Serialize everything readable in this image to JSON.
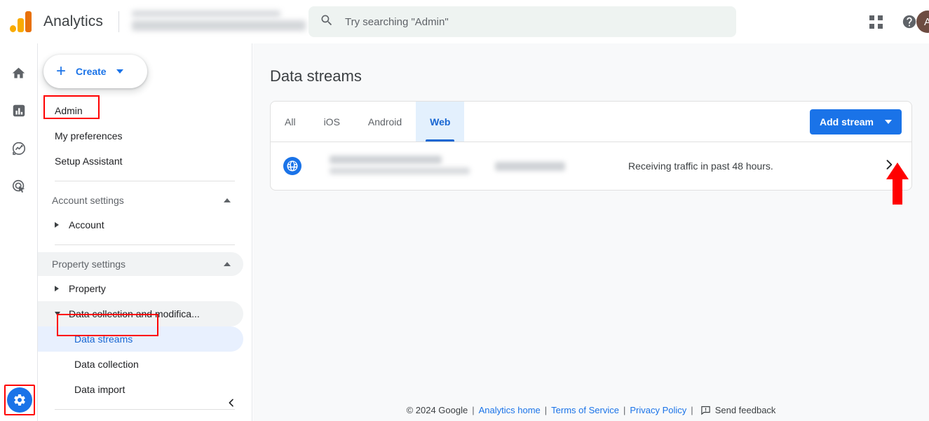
{
  "header": {
    "app_title": "Analytics",
    "account_blurred": true,
    "search_placeholder": "Try searching \"Admin\"",
    "search_icon": "search-icon",
    "apps_icon": "apps-grid-icon",
    "help_icon": "help-icon",
    "avatar_initial": "A"
  },
  "rail": {
    "items": [
      {
        "icon": "home-icon",
        "name": "home"
      },
      {
        "icon": "reports-bar-chart-icon",
        "name": "reports"
      },
      {
        "icon": "explore-icon",
        "name": "explore"
      },
      {
        "icon": "advertising-target-icon",
        "name": "advertising"
      }
    ],
    "admin_gear_icon": "gear-icon"
  },
  "sidebar": {
    "create_label": "Create",
    "create_icon": "plus-icon",
    "top_items": [
      {
        "label": "Admin",
        "selected": false,
        "annotated": true
      },
      {
        "label": "My preferences",
        "selected": false,
        "annotated": false
      },
      {
        "label": "Setup Assistant",
        "selected": false,
        "annotated": false
      }
    ],
    "sections": [
      {
        "title": "Account settings",
        "expanded": true,
        "items": [
          {
            "label": "Account",
            "expandable": true,
            "expanded": false,
            "selected": false
          }
        ]
      },
      {
        "title": "Property settings",
        "expanded": true,
        "items": [
          {
            "label": "Property",
            "expandable": true,
            "expanded": false,
            "selected": false
          },
          {
            "label": "Data collection and modifica...",
            "expandable": true,
            "expanded": true,
            "selected": false
          },
          {
            "label": "Data streams",
            "expandable": false,
            "selected": true,
            "annotated": true
          },
          {
            "label": "Data collection",
            "expandable": false,
            "selected": false
          },
          {
            "label": "Data import",
            "expandable": false,
            "selected": false
          }
        ]
      }
    ],
    "collapse_icon": "chevron-left-icon"
  },
  "main": {
    "page_title": "Data streams",
    "tabs": [
      {
        "label": "All",
        "active": false
      },
      {
        "label": "iOS",
        "active": false
      },
      {
        "label": "Android",
        "active": false
      },
      {
        "label": "Web",
        "active": true
      }
    ],
    "add_stream_label": "Add stream",
    "streams": [
      {
        "icon": "globe-icon",
        "name_blurred": true,
        "url_blurred": true,
        "measurement_id_blurred": true,
        "status": "Receiving traffic in past 48 hours.",
        "chevron": "chevron-right-icon"
      }
    ]
  },
  "footer": {
    "copyright": "© 2024 Google",
    "links": [
      {
        "label": "Analytics home"
      },
      {
        "label": "Terms of Service"
      },
      {
        "label": "Privacy Policy"
      }
    ],
    "feedback_label": "Send feedback",
    "feedback_icon": "feedback-icon"
  },
  "annotations": {
    "accent_red": "#ff0000",
    "boxes": [
      "admin",
      "data-streams",
      "admin-gear"
    ],
    "arrow": "points-to-stream-chevron"
  },
  "colors": {
    "brand_blue": "#1a73e8",
    "selected_blue_bg": "#e8f0fe",
    "tab_active_bg": "#e3f0fd",
    "page_bg": "#f8f9fa",
    "logo_orange": "#e8710a",
    "logo_yellow": "#f9ab00"
  }
}
